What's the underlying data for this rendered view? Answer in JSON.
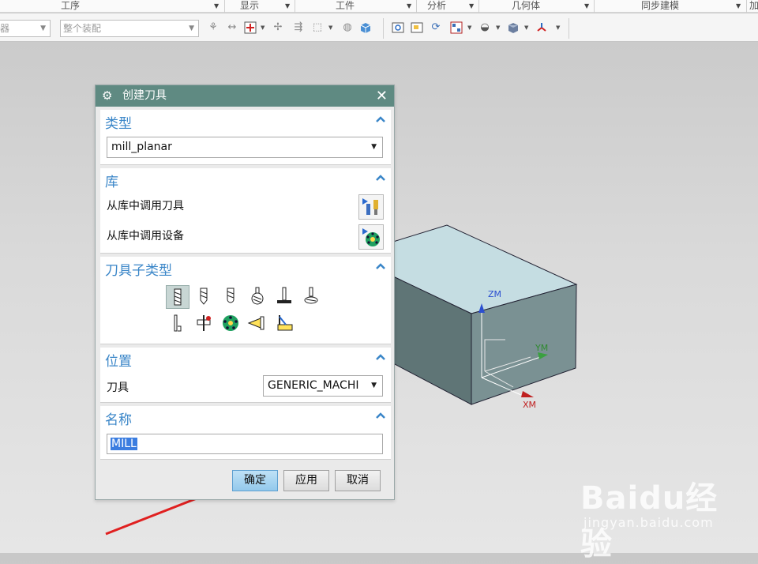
{
  "ribbon_groups": [
    "工序",
    "显示",
    "工件",
    "分析",
    "几何体",
    "同步建模",
    "加"
  ],
  "toolbar": {
    "filter_select_value": "器",
    "assembly_select_value": "整个装配"
  },
  "model": {
    "axis_labels": {
      "z": "ZM",
      "y": "YM",
      "x": "XM"
    }
  },
  "watermark": {
    "brand": "Baidu经验",
    "url": "jingyan.baidu.com"
  },
  "dialog": {
    "title": "创建刀具",
    "type_section": {
      "heading": "类型",
      "selected": "mill_planar"
    },
    "library_section": {
      "heading": "库",
      "retrieve_tool_label": "从库中调用刀具",
      "retrieve_device_label": "从库中调用设备"
    },
    "subtype_section": {
      "heading": "刀具子类型",
      "icons": [
        "mill-icon",
        "chamfer-mill-icon",
        "ball-mill-icon",
        "spherical-mill-icon",
        "t-cutter-icon",
        "barrel-cutter-icon",
        "thread-mill-icon",
        "mill-user-icon",
        "carrier-icon",
        "mcs-head-icon",
        "soft-tool-icon"
      ]
    },
    "location_section": {
      "heading": "位置",
      "tool_label": "刀具",
      "tool_value": "GENERIC_MACHI"
    },
    "name_section": {
      "heading": "名称",
      "value": "MILL"
    },
    "buttons": {
      "ok": "确定",
      "apply": "应用",
      "cancel": "取消"
    }
  },
  "colors": {
    "dialog_title_bg": "#5f8a82",
    "section_heading": "#3a86c8",
    "primary_button": "#93c9ec",
    "annotation_arrow": "#e02020"
  }
}
